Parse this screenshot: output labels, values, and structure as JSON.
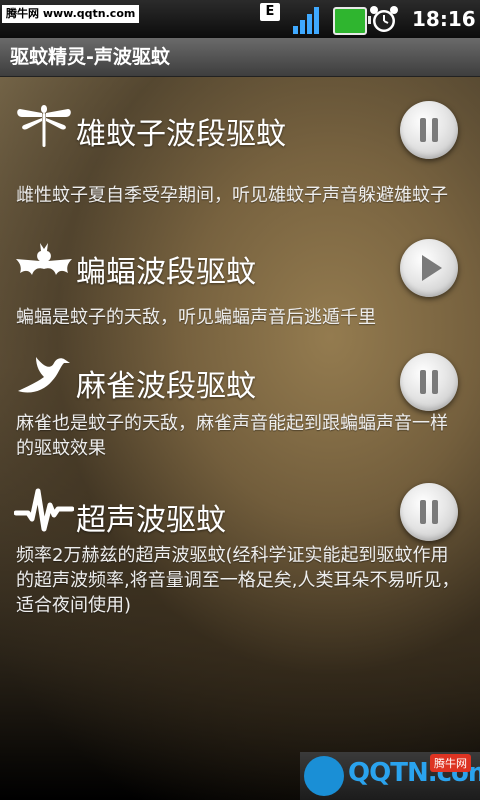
{
  "status_bar": {
    "watermark": "腾牛网 www.qqtn.com",
    "network_type": "E",
    "time": "18:16"
  },
  "app": {
    "title": "驱蚊精灵-声波驱蚊"
  },
  "modes": [
    {
      "icon": "dragonfly-icon",
      "title": "雄蚊子波段驱蚊",
      "description": "雌性蚊子夏自季受孕期间，听见雄蚊子声音躲避雄蚊子",
      "state": "playing"
    },
    {
      "icon": "bat-icon",
      "title": "蝙蝠波段驱蚊",
      "description": "蝙蝠是蚊子的天敌，听见蝙蝠声音后逃遁千里",
      "state": "stopped"
    },
    {
      "icon": "bird-icon",
      "title": "麻雀波段驱蚊",
      "description": "麻雀也是蚊子的天敌，麻雀声音能起到跟蝙蝠声音一样的驱蚊效果",
      "state": "playing"
    },
    {
      "icon": "waveform-icon",
      "title": "超声波驱蚊",
      "description": "频率2万赫兹的超声波驱蚊(经科学证实能起到驱蚊作用的超声波频率,将音量调至一格足矣,人类耳朵不易听见，适合夜间使用)",
      "state": "playing"
    }
  ],
  "footer_watermark": {
    "logo_text": "QQTN.com",
    "badge": "腾牛网"
  }
}
